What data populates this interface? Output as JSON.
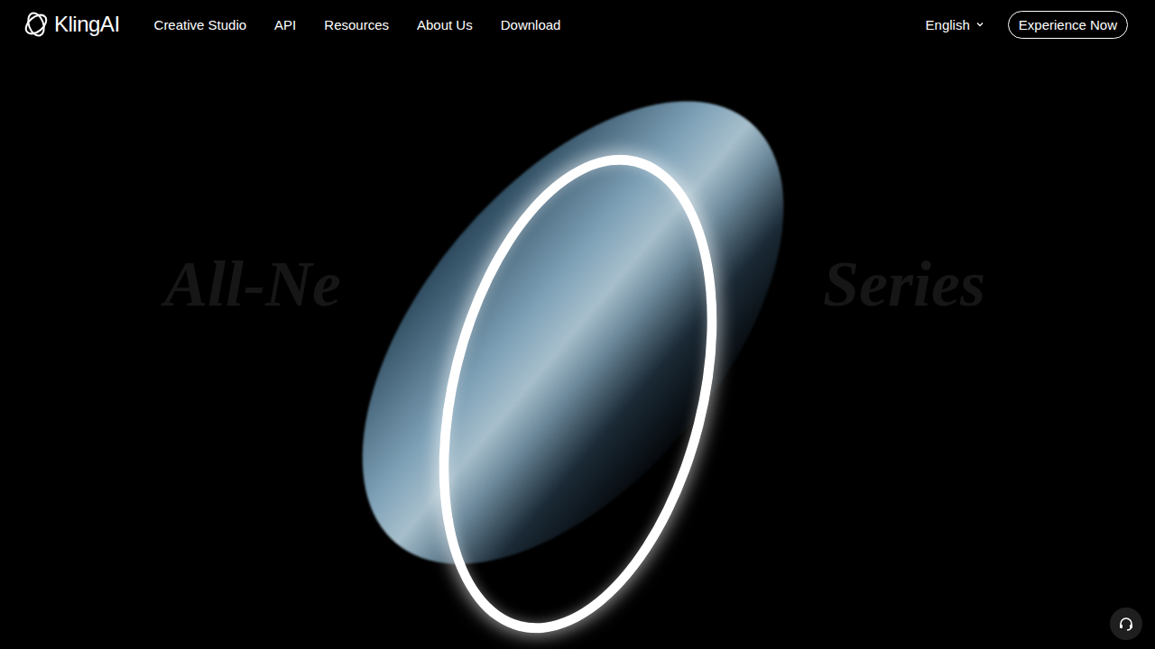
{
  "nav": {
    "logo": "KlingAI",
    "links": [
      "Creative Studio",
      "API",
      "Resources",
      "About Us",
      "Download"
    ],
    "language": "English",
    "cta": "Experience Now"
  },
  "hero": {
    "headline_left": "All-Ne",
    "headline_right": "Series"
  }
}
